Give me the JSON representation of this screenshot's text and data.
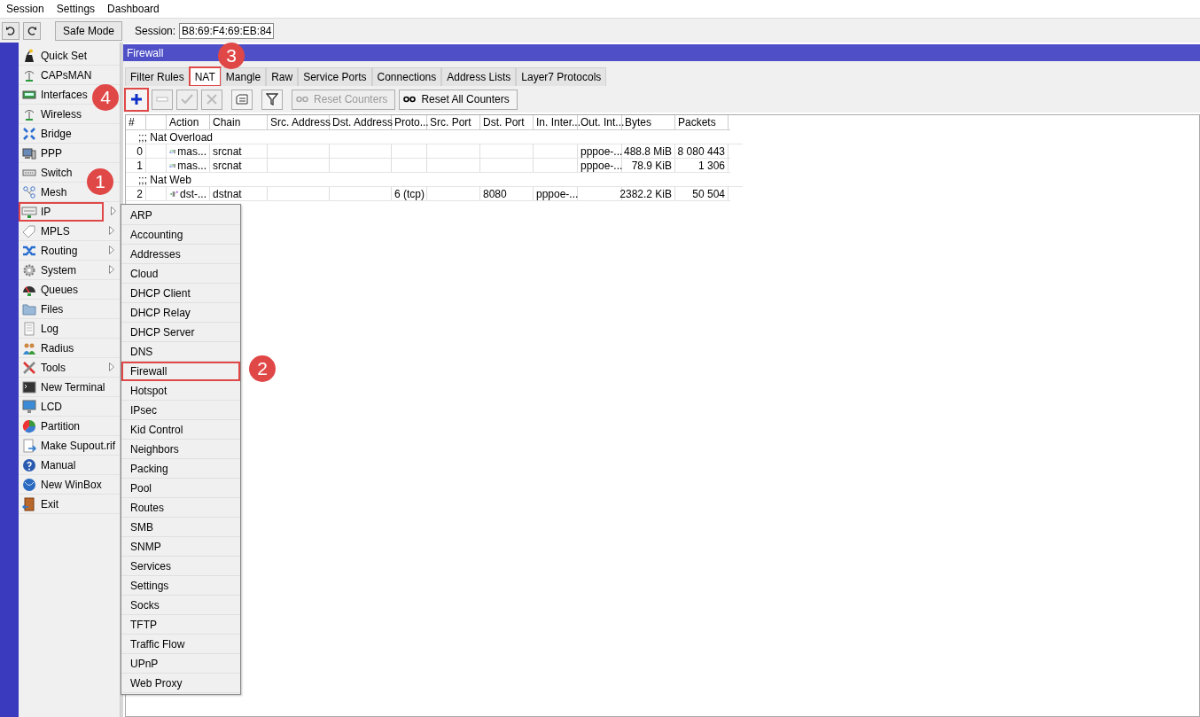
{
  "menu_bar": [
    "Session",
    "Settings",
    "Dashboard"
  ],
  "toolbar": {
    "safe_mode": "Safe Mode",
    "session_label": "Session:",
    "session_value": "B8:69:F4:69:EB:84"
  },
  "sidebar": {
    "items": [
      {
        "label": "Quick Set",
        "has_submenu": false,
        "highlighted": false
      },
      {
        "label": "CAPsMAN",
        "has_submenu": false,
        "highlighted": false
      },
      {
        "label": "Interfaces",
        "has_submenu": false,
        "highlighted": false
      },
      {
        "label": "Wireless",
        "has_submenu": false,
        "highlighted": false
      },
      {
        "label": "Bridge",
        "has_submenu": false,
        "highlighted": false
      },
      {
        "label": "PPP",
        "has_submenu": false,
        "highlighted": false
      },
      {
        "label": "Switch",
        "has_submenu": false,
        "highlighted": false
      },
      {
        "label": "Mesh",
        "has_submenu": false,
        "highlighted": false
      },
      {
        "label": "IP",
        "has_submenu": true,
        "highlighted": true
      },
      {
        "label": "MPLS",
        "has_submenu": true,
        "highlighted": false
      },
      {
        "label": "Routing",
        "has_submenu": true,
        "highlighted": false
      },
      {
        "label": "System",
        "has_submenu": true,
        "highlighted": false
      },
      {
        "label": "Queues",
        "has_submenu": false,
        "highlighted": false
      },
      {
        "label": "Files",
        "has_submenu": false,
        "highlighted": false
      },
      {
        "label": "Log",
        "has_submenu": false,
        "highlighted": false
      },
      {
        "label": "Radius",
        "has_submenu": false,
        "highlighted": false
      },
      {
        "label": "Tools",
        "has_submenu": true,
        "highlighted": false
      },
      {
        "label": "New Terminal",
        "has_submenu": false,
        "highlighted": false
      },
      {
        "label": "LCD",
        "has_submenu": false,
        "highlighted": false
      },
      {
        "label": "Partition",
        "has_submenu": false,
        "highlighted": false
      },
      {
        "label": "Make Supout.rif",
        "has_submenu": false,
        "highlighted": false
      },
      {
        "label": "Manual",
        "has_submenu": false,
        "highlighted": false
      },
      {
        "label": "New WinBox",
        "has_submenu": false,
        "highlighted": false
      },
      {
        "label": "Exit",
        "has_submenu": false,
        "highlighted": false
      }
    ]
  },
  "firewall": {
    "title": "Firewall",
    "tabs": [
      {
        "label": "Filter Rules",
        "selected": false,
        "highlighted": false
      },
      {
        "label": "NAT",
        "selected": true,
        "highlighted": true
      },
      {
        "label": "Mangle",
        "selected": false,
        "highlighted": false
      },
      {
        "label": "Raw",
        "selected": false,
        "highlighted": false
      },
      {
        "label": "Service Ports",
        "selected": false,
        "highlighted": false
      },
      {
        "label": "Connections",
        "selected": false,
        "highlighted": false
      },
      {
        "label": "Address Lists",
        "selected": false,
        "highlighted": false
      },
      {
        "label": "Layer7 Protocols",
        "selected": false,
        "highlighted": false
      }
    ],
    "tools": [
      {
        "kind": "add",
        "disabled": false,
        "highlighted": true
      },
      {
        "kind": "remove",
        "disabled": true,
        "highlighted": false
      },
      {
        "kind": "enable",
        "disabled": true,
        "highlighted": false
      },
      {
        "kind": "disable",
        "disabled": true,
        "highlighted": false
      },
      {
        "kind": "comment",
        "disabled": false,
        "highlighted": false
      },
      {
        "kind": "filter",
        "disabled": false,
        "highlighted": false
      },
      {
        "kind": "counter",
        "label": "Reset Counters",
        "disabled": true,
        "highlighted": false
      },
      {
        "kind": "counter",
        "label": "Reset All Counters",
        "disabled": false,
        "highlighted": false
      }
    ],
    "table": {
      "columns": [
        "#",
        null,
        "Action",
        "Chain",
        "Src. Address",
        "Dst. Address",
        "Proto...",
        "Src. Port",
        "Dst. Port",
        "In. Inter...",
        "Out. Int...",
        "Bytes",
        "Packets"
      ],
      "rows": [
        {
          "kind": "comment",
          "text": ";;; Nat Overload"
        },
        {
          "kind": "masquerade",
          "cells": [
            "0",
            null,
            "mas...",
            "srcnat",
            null,
            null,
            null,
            null,
            null,
            null,
            "pppoe-...",
            "488.8 MiB",
            "8 080 443"
          ]
        },
        {
          "kind": "masquerade",
          "cells": [
            "1",
            null,
            "mas...",
            "srcnat",
            null,
            null,
            null,
            null,
            null,
            null,
            "pppoe-...",
            "78.9 KiB",
            "1 306"
          ]
        },
        {
          "kind": "comment",
          "text": ";;; Nat Web"
        },
        {
          "kind": "dstnat",
          "cells": [
            "2",
            null,
            "dst-...",
            "dstnat",
            null,
            null,
            "6 (tcp)",
            null,
            "8080",
            "pppoe-...",
            null,
            "2382.2 KiB",
            "50 504"
          ]
        }
      ]
    }
  },
  "ip_submenu": {
    "items": [
      {
        "label": "ARP",
        "highlighted": false
      },
      {
        "label": "Accounting",
        "highlighted": false
      },
      {
        "label": "Addresses",
        "highlighted": false
      },
      {
        "label": "Cloud",
        "highlighted": false
      },
      {
        "label": "DHCP Client",
        "highlighted": false
      },
      {
        "label": "DHCP Relay",
        "highlighted": false
      },
      {
        "label": "DHCP Server",
        "highlighted": false
      },
      {
        "label": "DNS",
        "highlighted": false
      },
      {
        "label": "Firewall",
        "highlighted": true
      },
      {
        "label": "Hotspot",
        "highlighted": false
      },
      {
        "label": "IPsec",
        "highlighted": false
      },
      {
        "label": "Kid Control",
        "highlighted": false
      },
      {
        "label": "Neighbors",
        "highlighted": false
      },
      {
        "label": "Packing",
        "highlighted": false
      },
      {
        "label": "Pool",
        "highlighted": false
      },
      {
        "label": "Routes",
        "highlighted": false
      },
      {
        "label": "SMB",
        "highlighted": false
      },
      {
        "label": "SNMP",
        "highlighted": false
      },
      {
        "label": "Services",
        "highlighted": false
      },
      {
        "label": "Settings",
        "highlighted": false
      },
      {
        "label": "Socks",
        "highlighted": false
      },
      {
        "label": "TFTP",
        "highlighted": false
      },
      {
        "label": "Traffic Flow",
        "highlighted": false
      },
      {
        "label": "UPnP",
        "highlighted": false
      },
      {
        "label": "Web Proxy",
        "highlighted": false
      }
    ]
  },
  "callouts": [
    "1",
    "2",
    "3",
    "4"
  ]
}
